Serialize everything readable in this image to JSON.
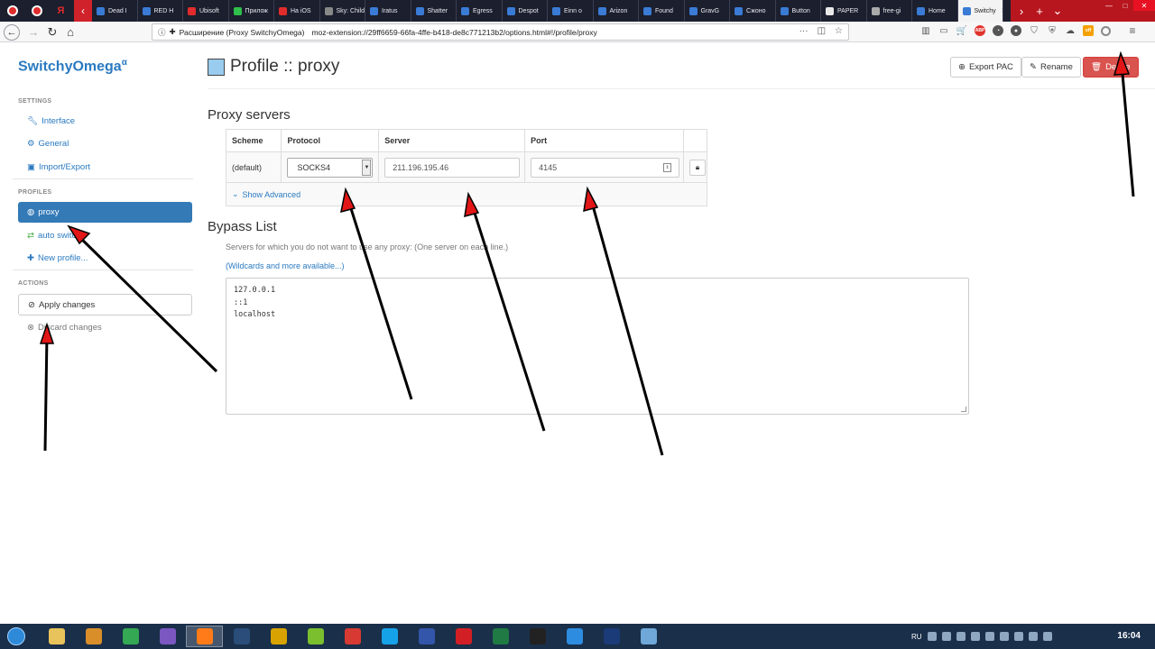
{
  "browser": {
    "tabs": [
      "Dead I",
      "RED H",
      "Ubisoft",
      "Прилож",
      "На iOS",
      "Sky: Childr",
      "Iratus",
      "Shatter",
      "Egress",
      "Despot",
      "Einn o",
      "Arizon",
      "Found",
      "GravG",
      "Сжоно",
      "Button",
      "PAPER",
      "free-gi",
      "Home",
      "Switchy"
    ],
    "tab_colors": [
      "#3a7bd5",
      "#3a7bd5",
      "#e02c2c",
      "#2ec04a",
      "#e02c2c",
      "#888888",
      "#3a7bd5",
      "#3a7bd5",
      "#3a7bd5",
      "#3a7bd5",
      "#3a7bd5",
      "#3a7bd5",
      "#3a7bd5",
      "#3a7bd5",
      "#3a7bd5",
      "#3a7bd5",
      "#e8e8e8",
      "#aaaaaa",
      "#3a7bd5",
      "#3a7bd5"
    ],
    "new_tab": "+",
    "tab_list": "⌄",
    "url_identity": "Расширение (Proxy SwitchyOmega)",
    "url": "moz-extension://29ff6659-66fa-4ffe-b418-de8c771213b2/options.html#!/profile/proxy",
    "url_menu": "···"
  },
  "sidebar": {
    "brand": "SwitchyOmega",
    "brand_sup": "α",
    "settings_title": "SETTINGS",
    "settings_items": [
      "Interface",
      "General",
      "Import/Export"
    ],
    "profiles_title": "PROFILES",
    "profile_items": [
      "proxy",
      "auto switch",
      "New profile..."
    ],
    "actions_title": "ACTIONS",
    "apply": "Apply changes",
    "discard": "Discard changes"
  },
  "main": {
    "title": "Profile :: proxy",
    "profile_color": "#99ccee",
    "buttons": {
      "export": "Export PAC",
      "rename": "Rename",
      "delete": "Delete"
    },
    "proxy_servers_heading": "Proxy servers",
    "table": {
      "headers": [
        "Scheme",
        "Protocol",
        "Server",
        "Port"
      ],
      "scheme": "(default)",
      "protocol": "SOCKS4",
      "server": "211.196.195.46",
      "port": "4145",
      "show_advanced": "Show Advanced"
    },
    "bypass_heading": "Bypass List",
    "bypass_help": "Servers for which you do not want to use any proxy: (One server on each line.)",
    "bypass_link": "(Wildcards and more available...)",
    "bypass_lines": [
      "127.0.0.1",
      "::1",
      "localhost"
    ]
  },
  "taskbar": {
    "apps": [
      "explorer",
      "media-player",
      "chrome",
      "viber",
      "firefox",
      "film-editor",
      "unknown",
      "utorrent",
      "vivaldi",
      "skype",
      "save",
      "opera",
      "excel",
      "app-orange",
      "uplay",
      "photoshop",
      "notepad"
    ],
    "app_colors": [
      "#e8c25a",
      "#d98e2a",
      "#34a853",
      "#7b57c2",
      "#ff7b1a",
      "#2a4d7a",
      "#d8a300",
      "#7bbf2e",
      "#d73a32",
      "#16a2e8",
      "#3355aa",
      "#d21f25",
      "#1f7a43",
      "#222222",
      "#2d8ce0",
      "#1b3a78",
      "#6ea7d8"
    ],
    "lang": "RU",
    "time": "16:04"
  },
  "colors": {
    "accent": "#2a7ac0",
    "active": "#337ab7",
    "danger": "#d9534f"
  }
}
